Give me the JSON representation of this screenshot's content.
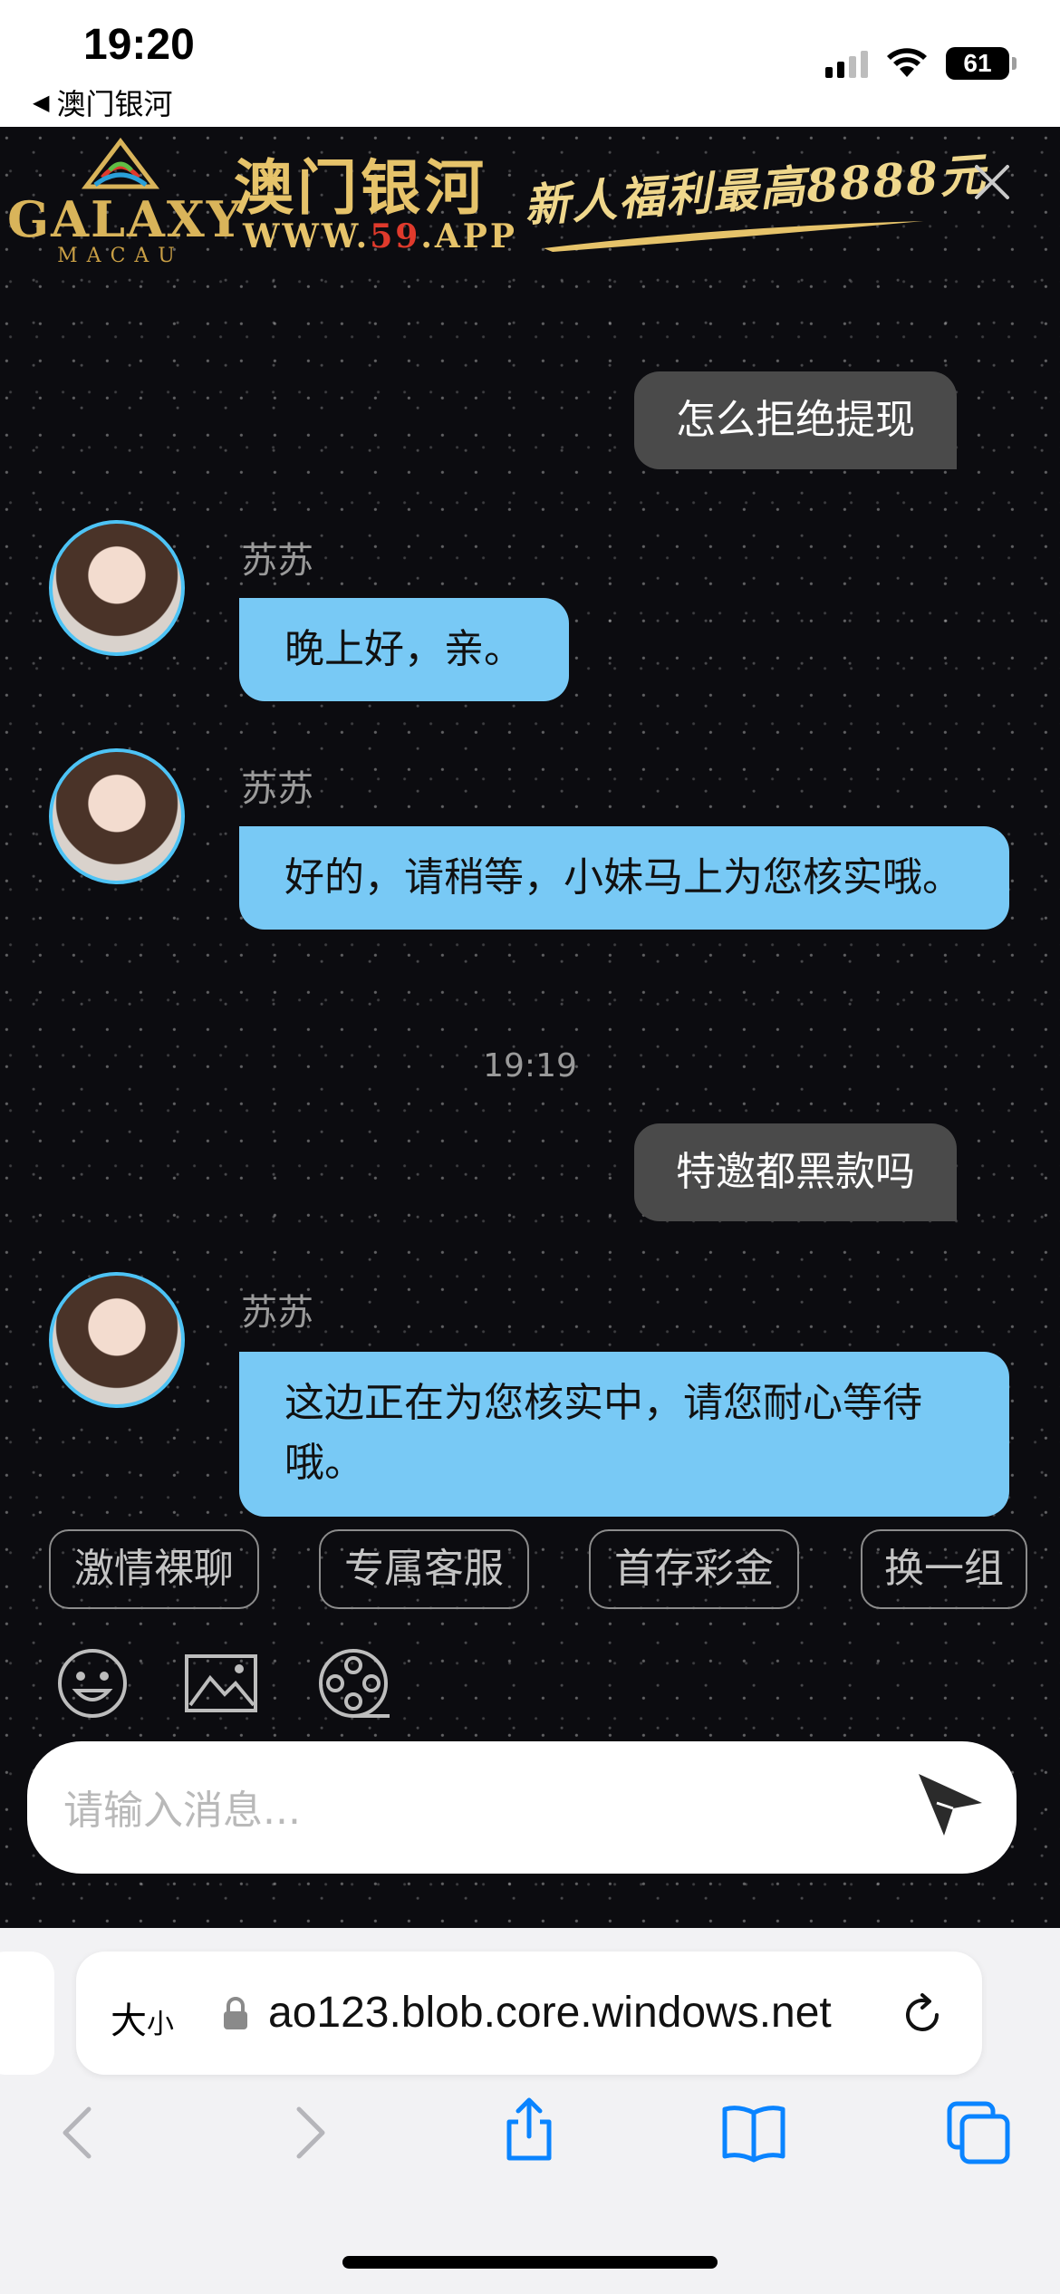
{
  "status_bar": {
    "time": "19:20",
    "back_app": "澳门银河",
    "battery": "61"
  },
  "banner": {
    "logo_word": "GALAXY",
    "logo_sub": "MACAU",
    "title": "澳门银河",
    "url_prefix": "WWW.",
    "url_number": "59",
    "url_suffix": ".APP",
    "promo": "新人福利最高8888元"
  },
  "messages": [
    {
      "type": "user",
      "text": "怎么拒绝提现"
    },
    {
      "type": "agent",
      "name": "苏苏",
      "text": "晚上好，亲。"
    },
    {
      "type": "agent",
      "name": "苏苏",
      "text": "好的，请稍等，小妹马上为您核实哦。"
    },
    {
      "type": "time",
      "text": "19:19"
    },
    {
      "type": "user",
      "text": "特邀都黑款吗"
    },
    {
      "type": "agent",
      "name": "苏苏",
      "text": "这边正在为您核实中，请您耐心等待哦。"
    }
  ],
  "quick_replies": [
    "激情裸聊",
    "专属客服",
    "首存彩金",
    "换一组"
  ],
  "tools": [
    "emoji-icon",
    "image-icon",
    "film-reel-icon"
  ],
  "input": {
    "placeholder": "请输入消息..."
  },
  "safari": {
    "aa_label": "大",
    "aa_small": "小",
    "url": "ao123.blob.core.windows.net"
  },
  "colors": {
    "agent_bubble": "#78c9f5",
    "user_bubble": "#4a4a4a",
    "chat_bg": "#0c0c10",
    "ios_blue": "#0a84ff"
  }
}
